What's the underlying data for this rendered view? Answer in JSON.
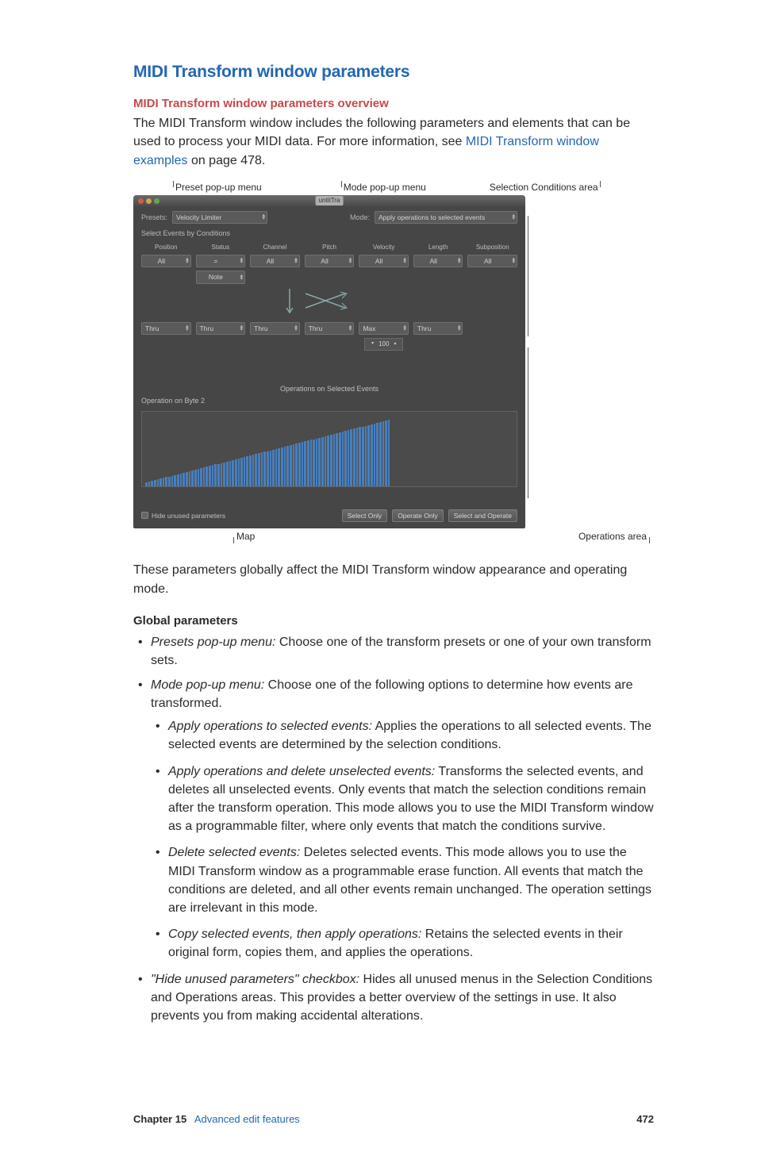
{
  "title": "MIDI Transform window parameters",
  "subtitle": "MIDI Transform window parameters overview",
  "intro": {
    "part1": "The MIDI Transform window includes the following parameters and elements that can be used to process your MIDI data. For more information, see ",
    "link": "MIDI Transform window examples",
    "part2": " on page 478."
  },
  "callouts": {
    "preset": "Preset pop-up menu",
    "mode": "Mode pop-up menu",
    "selcond": "Selection Conditions area",
    "map": "Map",
    "ops": "Operations area"
  },
  "window": {
    "titlebar": "untitTra",
    "presets_label": "Presets:",
    "preset_value": "Velocity Limiter",
    "mode_label": "Mode:",
    "mode_value": "Apply operations to selected events",
    "select_label": "Select Events by Conditions",
    "columns": [
      "Position",
      "Status",
      "Channel",
      "Pitch",
      "Velocity",
      "Length",
      "Subposition"
    ],
    "cond_values": [
      "All",
      "=",
      "All",
      "All",
      "All",
      "All",
      "All"
    ],
    "status_note": "Note",
    "ops_center": "Operations on Selected Events",
    "ops_values": [
      "Thru",
      "Thru",
      "Thru",
      "Thru",
      "Max",
      "Thru"
    ],
    "vel_num": "100",
    "byte2": "Operation on Byte 2",
    "hide": "Hide unused parameters",
    "btn_select": "Select Only",
    "btn_operate": "Operate Only",
    "btn_both": "Select and Operate"
  },
  "after_fig": "These parameters globally affect the MIDI Transform window appearance and operating mode.",
  "global_h": "Global parameters",
  "bullets": {
    "presets": {
      "term": "Presets pop-up menu:",
      "text": " Choose one of the transform presets or one of your own transform sets."
    },
    "mode": {
      "term": "Mode pop-up menu:",
      "text": " Choose one of the following options to determine how events are transformed."
    },
    "mode_sub": [
      {
        "term": "Apply operations to selected events:",
        "text": " Applies the operations to all selected events. The selected events are determined by the selection conditions."
      },
      {
        "term": "Apply operations and delete unselected events:",
        "text": " Transforms the selected events, and deletes all unselected events. Only events that match the selection conditions remain after the transform operation. This mode allows you to use the MIDI Transform window as a programmable filter, where only events that match the conditions survive."
      },
      {
        "term": "Delete selected events:",
        "text": " Deletes selected events. This mode allows you to use the MIDI Transform window as a programmable erase function. All events that match the conditions are deleted, and all other events remain unchanged. The operation settings are irrelevant in this mode."
      },
      {
        "term": "Copy selected events, then apply operations:",
        "text": " Retains the selected events in their original form, copies them, and applies the operations."
      }
    ],
    "hide": {
      "term": "\"Hide unused parameters\" checkbox:",
      "text": " Hides all unused menus in the Selection Conditions and Operations areas. This provides a better overview of the settings in use. It also prevents you from making accidental alterations."
    }
  },
  "footer": {
    "chapter_label": "Chapter  15",
    "chapter_name": "Advanced edit features",
    "page": "472"
  },
  "chart_data": {
    "type": "bar",
    "title": "Operation on Byte 2",
    "xlabel": "",
    "ylabel": "",
    "ylim": [
      0,
      127
    ],
    "categories_count": 128,
    "values": "linear ramp from ~5 to ~90 over ~85 bars then flat/empty"
  }
}
